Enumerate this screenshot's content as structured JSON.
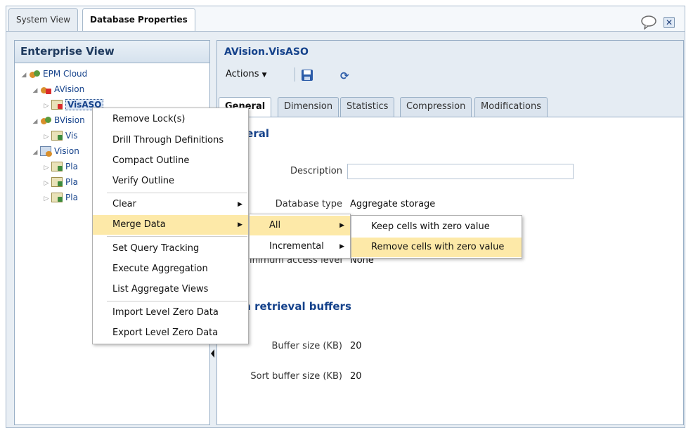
{
  "top_tabs": [
    {
      "label": "System View",
      "active": false
    },
    {
      "label": "Database Properties",
      "active": true
    }
  ],
  "icons": {
    "chat": "chat-bubble-icon",
    "close": "close-icon",
    "close_glyph": "✕"
  },
  "enterprise_view": {
    "title": "Enterprise View",
    "tree": [
      {
        "label": "EPM Cloud",
        "icon": "cloud-server-icon",
        "expanded": true
      },
      {
        "label": "AVision",
        "icon": "application-locked-icon",
        "expanded": true
      },
      {
        "label": "VisASO",
        "icon": "database-locked-icon",
        "selected": true
      },
      {
        "label": "BVision",
        "icon": "application-icon",
        "expanded": true
      },
      {
        "label": "Vis",
        "icon": "database-icon"
      },
      {
        "label": "Vision",
        "icon": "application-icon",
        "expanded": true
      },
      {
        "label": "Pla",
        "icon": "database-icon"
      },
      {
        "label": "Pla",
        "icon": "database-icon"
      },
      {
        "label": "Pla",
        "icon": "database-icon"
      }
    ]
  },
  "right_panel": {
    "title": "AVision.VisASO",
    "actions_label": "Actions",
    "tabs": [
      "General",
      "Dimension",
      "Statistics",
      "Compression",
      "Modifications"
    ],
    "general": {
      "section_title": "General",
      "description_label": "Description",
      "description_value": "",
      "database_type_label": "Database type",
      "database_type_value": "Aggregate storage",
      "min_access_label": "Minimum access level",
      "min_access_value": "None"
    },
    "buffers": {
      "section_title": "Data retrieval buffers",
      "buffer_size_label": "Buffer size (KB)",
      "buffer_size_value": "20",
      "sort_buffer_label": "Sort buffer size (KB)",
      "sort_buffer_value": "20"
    }
  },
  "context_menu": {
    "items": [
      "Remove Lock(s)",
      "Drill Through Definitions",
      "Compact Outline",
      "Verify Outline",
      "Clear",
      "Merge Data",
      "Set Query Tracking",
      "Execute Aggregation",
      "List Aggregate Views",
      "Import Level Zero Data",
      "Export Level Zero Data"
    ],
    "highlighted": "Merge Data"
  },
  "submenu_merge": {
    "items": [
      "All",
      "Incremental"
    ],
    "highlighted": "All"
  },
  "submenu_all": {
    "items": [
      "Keep cells with zero value",
      "Remove cells with zero value"
    ],
    "highlighted": "Remove cells with zero value"
  },
  "colors": {
    "menu_highlight": "#fde9a8",
    "panel_border": "#99afc6",
    "title_blue": "#15428b"
  }
}
